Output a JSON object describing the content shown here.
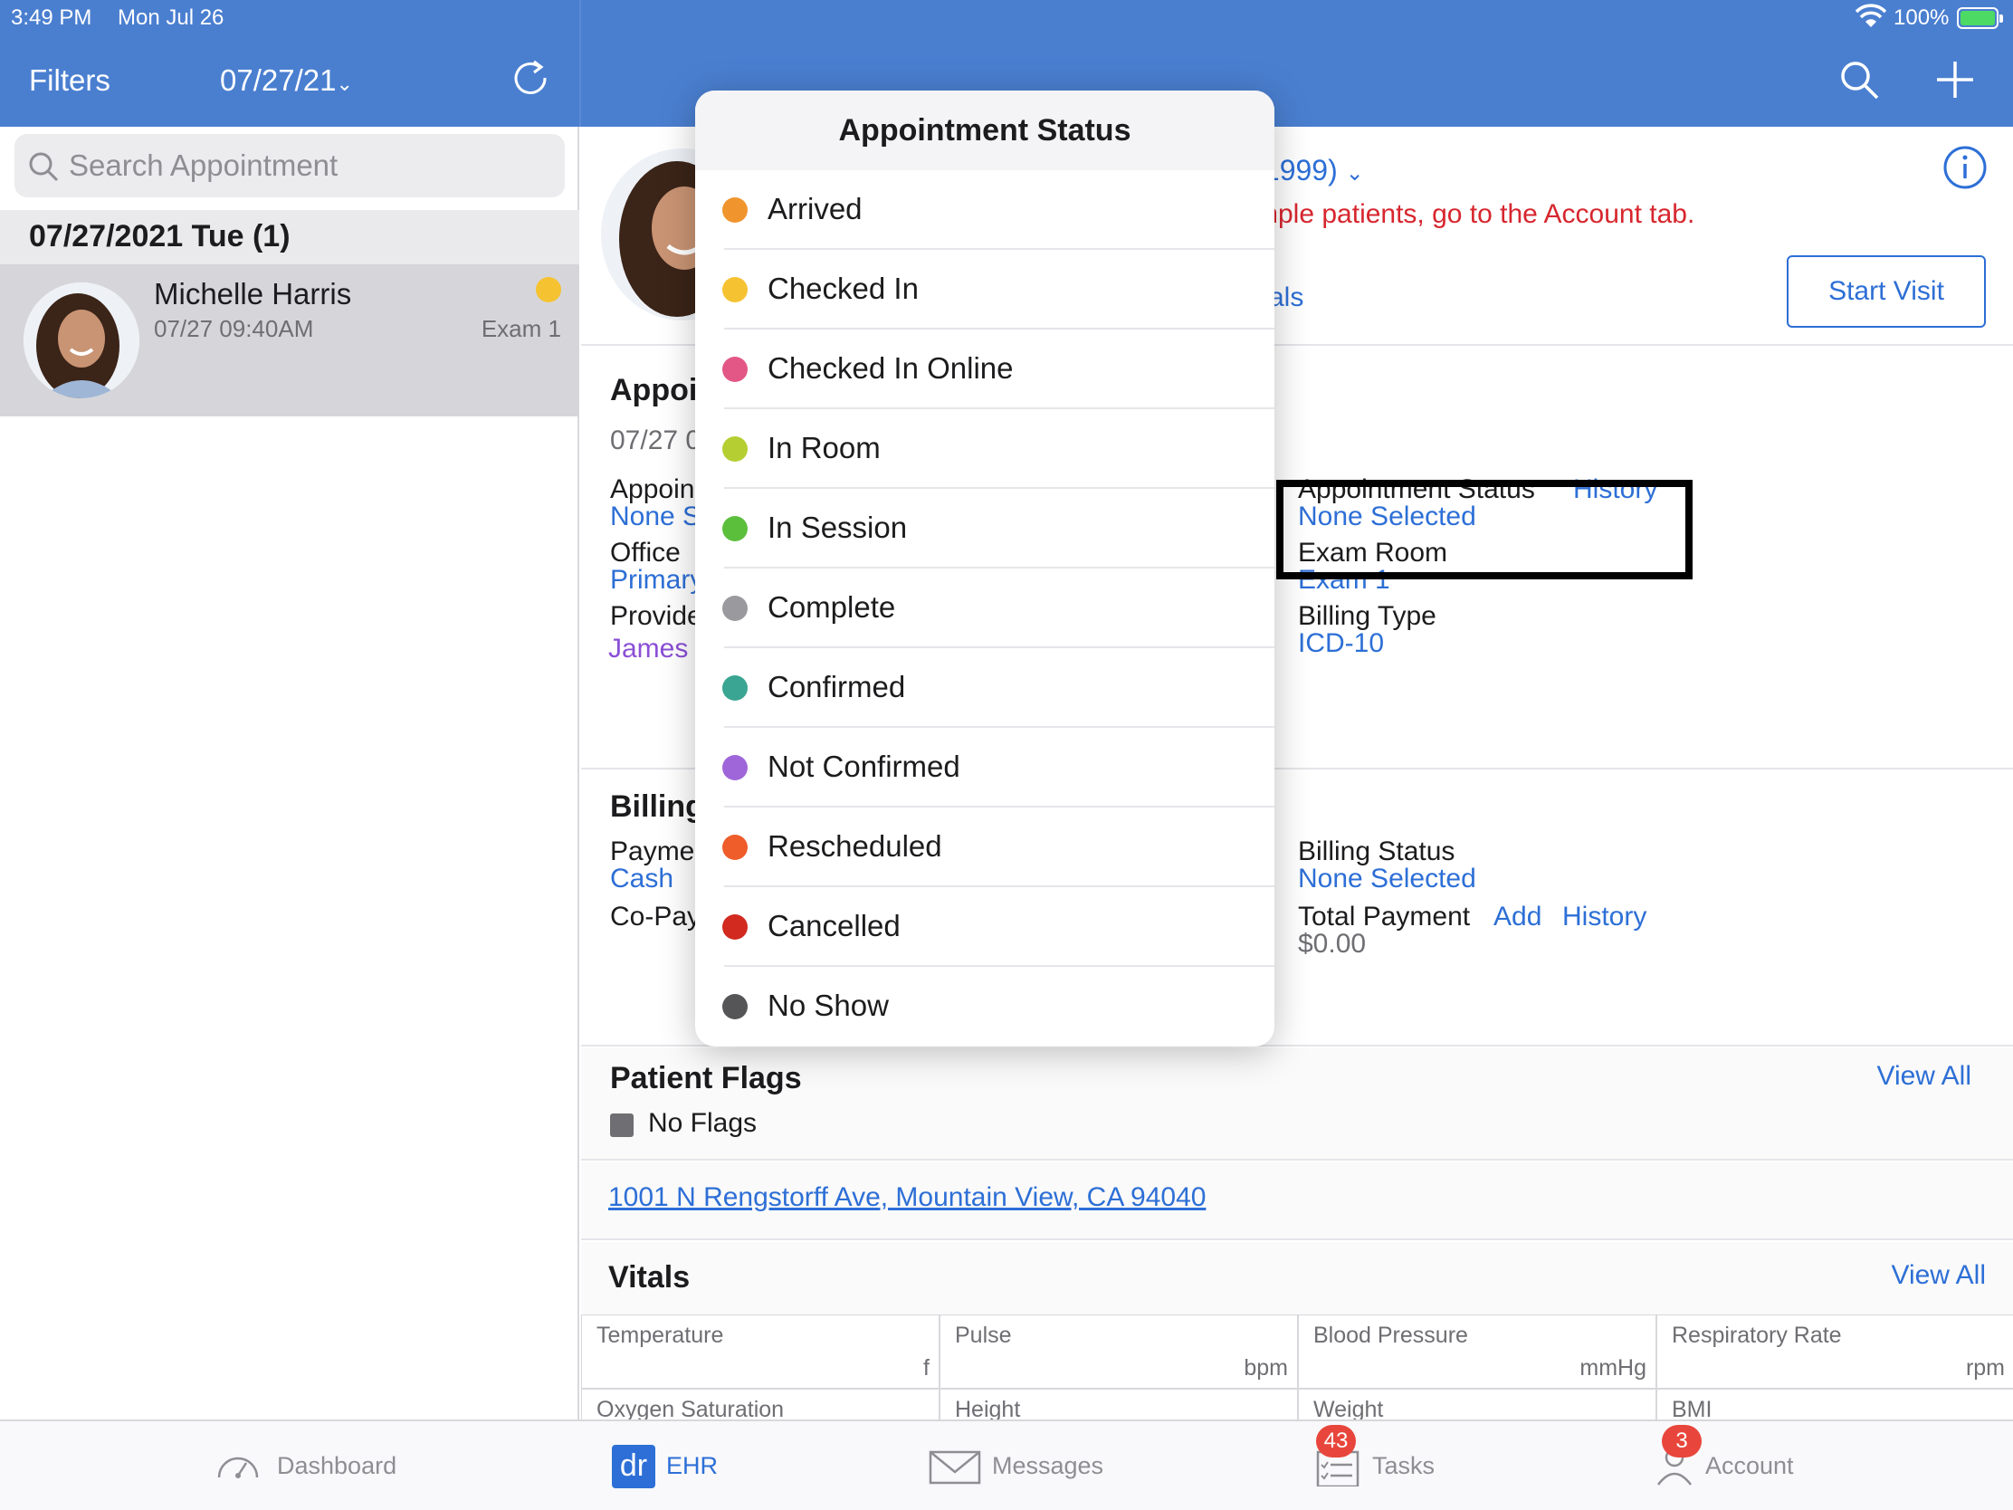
{
  "status_bar": {
    "time": "3:49 PM",
    "date": "Mon Jul 26",
    "battery": "100%"
  },
  "left_header": {
    "filters_label": "Filters",
    "date_filter": "07/27/21"
  },
  "search": {
    "placeholder": "Search Appointment"
  },
  "date_section": "07/27/2021 Tue (1)",
  "appointment": {
    "name": "Michelle Harris",
    "time": "07/27 09:40AM",
    "room": "Exam 1",
    "status_color": "#f5c231"
  },
  "header": {
    "dob_fragment": "/1999)",
    "sample_message": "mple patients, go to the Account tab.",
    "vitals_fragment": "itals",
    "start_visit": "Start Visit"
  },
  "appointment_details": {
    "section_title": "Appoi",
    "date_fragment": "07/27 0",
    "appointment_label": "Appoin",
    "appointment_value": "None S",
    "office_label": "Office",
    "office_value": "Primary",
    "provider_label": "Provide",
    "provider_value": "James",
    "status_label": "Appointment Status",
    "status_history": "History",
    "status_value": "None Selected",
    "exam_room_label": "Exam Room",
    "exam_room_value": "Exam 1",
    "billing_type_label": "Billing Type",
    "billing_type_value": "ICD-10"
  },
  "billing": {
    "section_title": "Billing",
    "payment_label": "Payme",
    "payment_value": "Cash",
    "copay_label": "Co-Pay",
    "billing_status_label": "Billing Status",
    "billing_status_value": "None Selected",
    "total_payment_label": "Total Payment",
    "total_payment_add": "Add",
    "total_payment_history": "History",
    "total_payment_value": "$0.00"
  },
  "flags": {
    "title": "Patient Flags",
    "view_all": "View All",
    "value": "No Flags"
  },
  "address": "1001 N Rengstorff Ave, Mountain View, CA 94040",
  "vitals": {
    "title": "Vitals",
    "view_all": "View All",
    "row1": [
      {
        "name": "Temperature",
        "unit": "f"
      },
      {
        "name": "Pulse",
        "unit": "bpm"
      },
      {
        "name": "Blood Pressure",
        "unit": "mmHg"
      },
      {
        "name": "Respiratory Rate",
        "unit": "rpm"
      }
    ],
    "row2": [
      {
        "name": "Oxygen Saturation"
      },
      {
        "name": "Height"
      },
      {
        "name": "Weight"
      },
      {
        "name": "BMI"
      }
    ]
  },
  "popover": {
    "title": "Appointment Status",
    "items": [
      {
        "label": "Arrived",
        "color": "#f0952e"
      },
      {
        "label": "Checked In",
        "color": "#f5c231"
      },
      {
        "label": "Checked In Online",
        "color": "#e25786"
      },
      {
        "label": "In Room",
        "color": "#b5cf32"
      },
      {
        "label": "In Session",
        "color": "#5cbf3c"
      },
      {
        "label": "Complete",
        "color": "#9a9a9e"
      },
      {
        "label": "Confirmed",
        "color": "#3aa592"
      },
      {
        "label": "Not Confirmed",
        "color": "#9f66d9"
      },
      {
        "label": "Rescheduled",
        "color": "#ee5d2a"
      },
      {
        "label": "Cancelled",
        "color": "#d22a1f"
      },
      {
        "label": "No Show",
        "color": "#555558"
      }
    ]
  },
  "tabbar": {
    "dashboard": "Dashboard",
    "ehr": "EHR",
    "messages": "Messages",
    "tasks": "Tasks",
    "tasks_badge": "43",
    "account": "Account",
    "account_badge": "3"
  }
}
